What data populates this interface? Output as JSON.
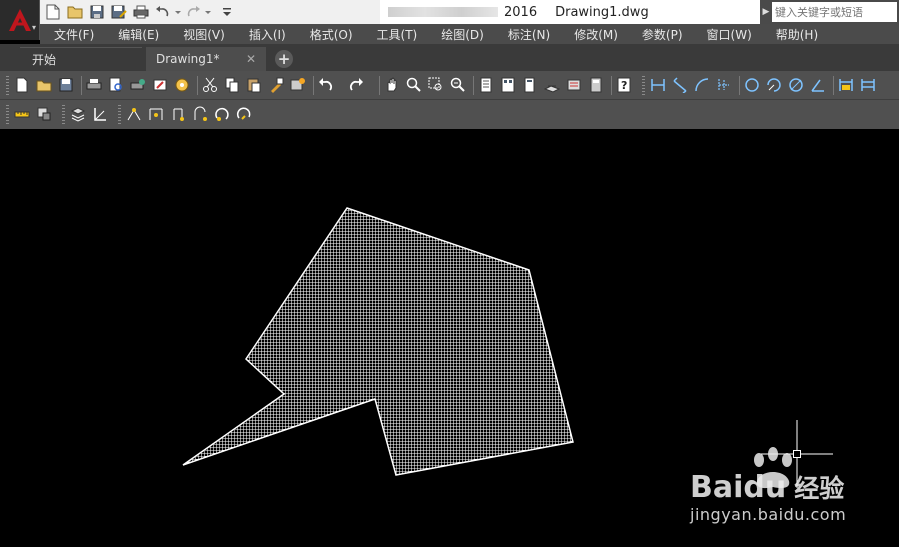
{
  "app": {
    "doc_version": "2016",
    "doc_name": "Drawing1.dwg"
  },
  "search": {
    "placeholder": "键入关键字或短语"
  },
  "menu": {
    "items": [
      "文件(F)",
      "编辑(E)",
      "视图(V)",
      "插入(I)",
      "格式(O)",
      "工具(T)",
      "绘图(D)",
      "标注(N)",
      "修改(M)",
      "参数(P)",
      "窗口(W)",
      "帮助(H)"
    ]
  },
  "tabs": {
    "start_label": "开始",
    "drawing_label": "Drawing1*",
    "close_glyph": "✕",
    "add_glyph": "+"
  },
  "toolbars": {
    "standard": [
      "qnew-icon",
      "open-icon",
      "save-icon",
      "plot-icon",
      "plot-preview-icon",
      "publish-icon",
      "3d-print-icon",
      "design-center-icon",
      "cut-icon",
      "copy-icon",
      "paste-icon",
      "match-properties-icon",
      "block-editor-icon",
      "undo-icon",
      "redo-icon",
      "pan-icon",
      "zoom-realtime-icon",
      "zoom-window-icon",
      "zoom-previous-icon",
      "properties-icon",
      "design-center-palette-icon",
      "tool-palettes-icon",
      "sheet-set-icon",
      "markup-icon",
      "quickcalc-icon",
      "help-icon"
    ],
    "dimension": [
      "dim-linear-icon",
      "dim-aligned-icon",
      "dim-arc-icon",
      "dim-ordinate-icon",
      "dim-radius-icon",
      "dim-jogged-icon",
      "dim-diameter-icon",
      "dim-angular-icon",
      "dim-quick-icon",
      "dim-baseline-icon"
    ],
    "secondary": [
      "measure-icon",
      "block-icon",
      "layer-icon",
      "ucs-icon",
      "param-point-icon",
      "param-linear-icon",
      "param-polar-icon",
      "param-xy-icon",
      "param-rotation-icon",
      "param-flip-icon"
    ]
  },
  "watermark": {
    "brand": "Bai",
    "brand_suffix": "du",
    "brand_cn": "经验",
    "url": "jingyan.baidu.com"
  },
  "colors": {
    "accent": "#c0161d",
    "hatch": "#ffffff",
    "canvas": "#000000"
  }
}
